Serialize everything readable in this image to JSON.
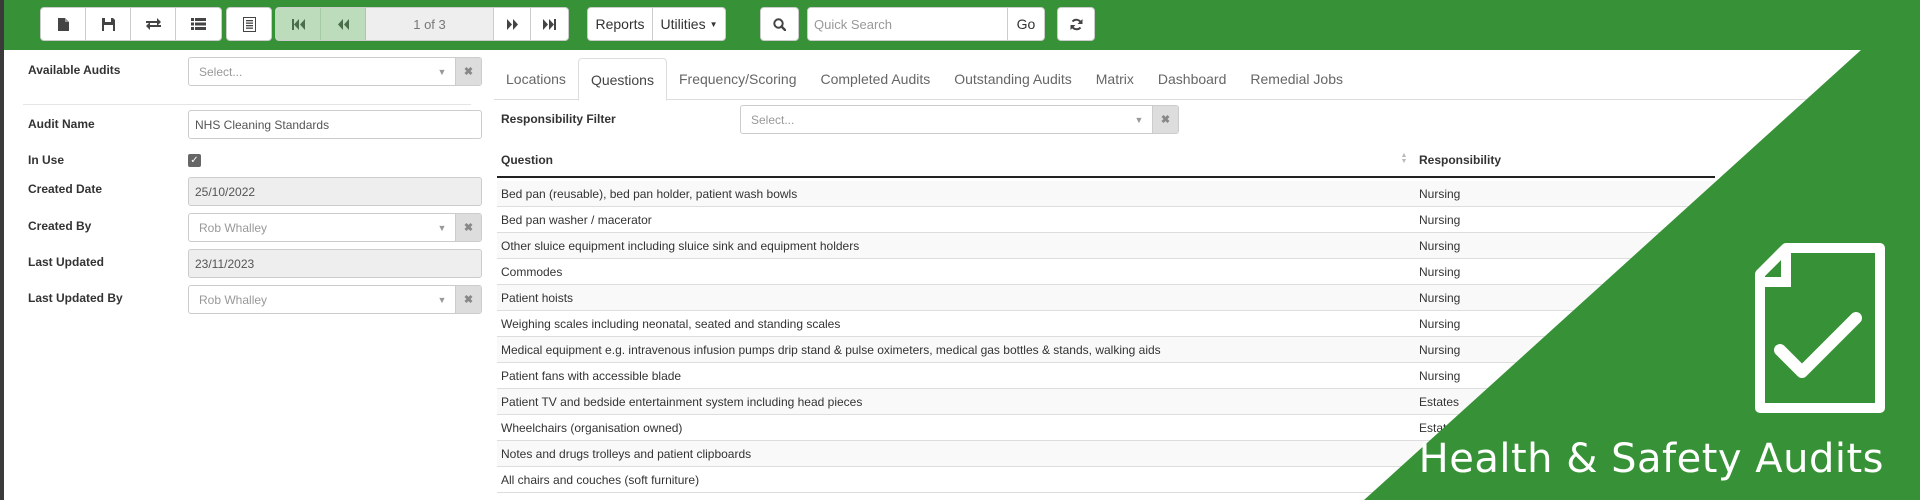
{
  "toolbar": {
    "pager": {
      "label": "1 of 3"
    },
    "reports_label": "Reports",
    "utilities_label": "Utilities",
    "quick_search": {
      "placeholder": "Quick Search",
      "value": ""
    },
    "go_label": "Go",
    "icons": {
      "new": "file-icon",
      "save": "save-icon",
      "transfer": "exchange-icon",
      "list": "list-icon",
      "report": "document-list-icon",
      "first": "first-page-icon",
      "prev": "previous-page-icon",
      "next": "next-page-icon",
      "last": "last-page-icon",
      "search": "search-icon",
      "refresh": "refresh-icon"
    }
  },
  "form": {
    "available_audits": {
      "label": "Available Audits",
      "placeholder": "Select..."
    },
    "audit_name": {
      "label": "Audit Name",
      "value": "NHS Cleaning Standards"
    },
    "in_use": {
      "label": "In Use",
      "checked": true
    },
    "created_date": {
      "label": "Created Date",
      "value": "25/10/2022"
    },
    "created_by": {
      "label": "Created By",
      "value": "Rob Whalley"
    },
    "last_updated": {
      "label": "Last Updated",
      "value": "23/11/2023"
    },
    "last_updated_by": {
      "label": "Last Updated By",
      "value": "Rob Whalley"
    }
  },
  "tabs": [
    {
      "label": "Locations",
      "active": false
    },
    {
      "label": "Questions",
      "active": true
    },
    {
      "label": "Frequency/Scoring",
      "active": false
    },
    {
      "label": "Completed Audits",
      "active": false
    },
    {
      "label": "Outstanding Audits",
      "active": false
    },
    {
      "label": "Matrix",
      "active": false
    },
    {
      "label": "Dashboard",
      "active": false
    },
    {
      "label": "Remedial Jobs",
      "active": false
    }
  ],
  "filter": {
    "label": "Responsibility Filter",
    "placeholder": "Select..."
  },
  "table": {
    "columns": [
      "Question",
      "Responsibility"
    ],
    "rows": [
      {
        "question": "Bed pan (reusable), bed pan holder, patient wash bowls",
        "responsibility": "Nursing"
      },
      {
        "question": "Bed pan washer / macerator",
        "responsibility": "Nursing"
      },
      {
        "question": "Other sluice equipment including sluice sink and equipment holders",
        "responsibility": "Nursing"
      },
      {
        "question": "Commodes",
        "responsibility": "Nursing"
      },
      {
        "question": "Patient hoists",
        "responsibility": "Nursing"
      },
      {
        "question": "Weighing scales including neonatal, seated and standing scales",
        "responsibility": "Nursing"
      },
      {
        "question": "Medical equipment e.g. intravenous infusion pumps drip stand & pulse oximeters, medical gas bottles & stands, walking aids",
        "responsibility": "Nursing"
      },
      {
        "question": "Patient fans with accessible blade",
        "responsibility": "Nursing"
      },
      {
        "question": "Patient TV and bedside entertainment system including head pieces",
        "responsibility": "Estates"
      },
      {
        "question": "Wheelchairs (organisation owned)",
        "responsibility": "Estates"
      },
      {
        "question": "Notes and drugs trolleys and patient clipboards",
        "responsibility": ""
      },
      {
        "question": "All chairs and couches (soft furniture)",
        "responsibility": ""
      }
    ]
  },
  "branding": {
    "title": "Health & Safety Audits",
    "icon": "checklist-document-icon",
    "color": "#379237"
  }
}
